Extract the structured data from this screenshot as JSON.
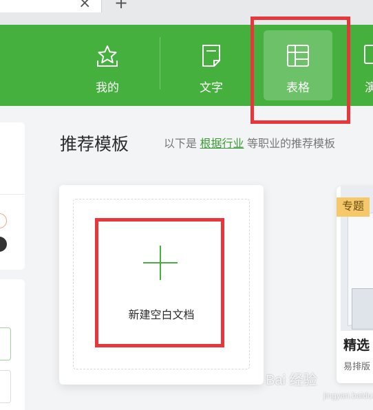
{
  "browser": {
    "close_glyph": "×",
    "new_tab_glyph": "+"
  },
  "nav": {
    "items": [
      {
        "label": "我的",
        "icon": "star-tray-icon"
      },
      {
        "label": "文字",
        "icon": "document-icon"
      },
      {
        "label": "表格",
        "icon": "table-icon",
        "active": true
      },
      {
        "label": "演",
        "icon": "presentation-icon"
      }
    ],
    "bg_color": "#45b03e"
  },
  "section": {
    "title": "推荐模板",
    "desc_prefix": "以下是",
    "desc_link": "根据行业",
    "desc_suffix": "等职业的推荐模板"
  },
  "new_blank": {
    "label": "新建空白文档"
  },
  "template_card": {
    "badge": "专题",
    "title": "精选",
    "subtitle": "易排版"
  },
  "watermark": {
    "text": "Bai 经验",
    "sub": "jingyan.baidu.com"
  },
  "annotation_color": "#e8373b"
}
